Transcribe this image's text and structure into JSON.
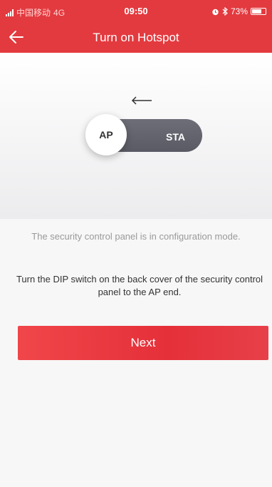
{
  "status_bar": {
    "carrier": "中国移动",
    "network": "4G",
    "time": "09:50",
    "battery": "73%",
    "battery_level": 0.73
  },
  "nav": {
    "title": "Turn on Hotspot",
    "back_icon": "back-arrow-icon"
  },
  "illustration": {
    "switch_left_label": "AP",
    "switch_right_label": "STA",
    "arrow_icon": "left-arrow-icon"
  },
  "mode_text": "The security control panel is in configuration mode.",
  "instruction": "Turn the DIP switch on the back cover of the security control panel to the AP end.",
  "next_button": "Next",
  "colors": {
    "brand": "#e33a3f",
    "switch_track": "#63636d"
  }
}
